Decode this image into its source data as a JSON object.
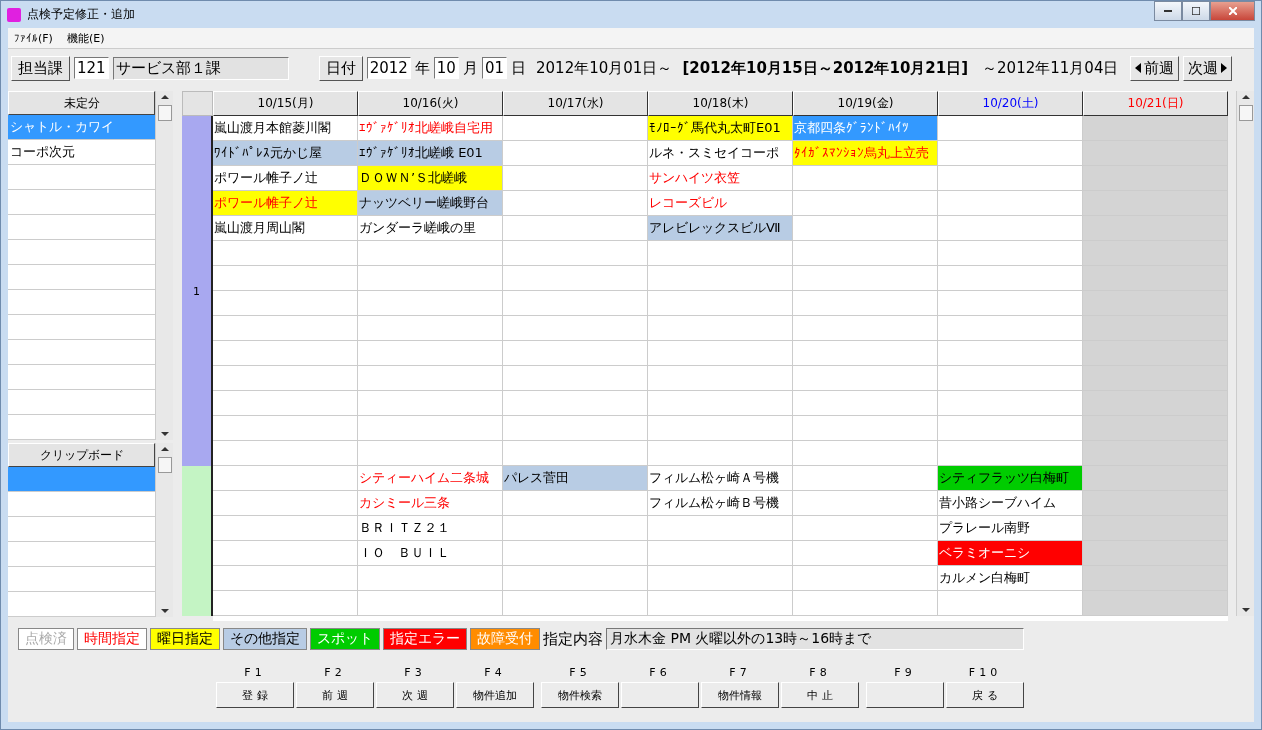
{
  "window": {
    "title": "点検予定修正・追加"
  },
  "menu": [
    {
      "label": "ﾌｧｲﾙ(F)"
    },
    {
      "label": "機能(E)"
    }
  ],
  "toolbar": {
    "department_label": "担当課",
    "department_code": "121",
    "department_name": "サービス部１課",
    "date_label": "日付",
    "year": "2012",
    "year_unit": "年",
    "month": "10",
    "month_unit": "月",
    "day": "01",
    "day_unit": "日",
    "range_start": "2012年10月01日～",
    "current_week": "[2012年10月15日～2012年10月21日]",
    "range_end": "～2012年11月04日",
    "prev_button": "前週",
    "next_button": "次週"
  },
  "unscheduled": {
    "title": "未定分",
    "items": [
      {
        "label": "シャトル・カワイ",
        "selected": true
      },
      {
        "label": "コーポ次元",
        "selected": false
      }
    ]
  },
  "clipboard": {
    "title": "クリップボード",
    "items": [
      {
        "selected": true
      }
    ]
  },
  "schedule": {
    "days": [
      {
        "label": "10/15(月)",
        "kind": "weekday"
      },
      {
        "label": "10/16(火)",
        "kind": "weekday"
      },
      {
        "label": "10/17(水)",
        "kind": "weekday"
      },
      {
        "label": "10/18(木)",
        "kind": "weekday"
      },
      {
        "label": "10/19(金)",
        "kind": "weekday"
      },
      {
        "label": "10/20(土)",
        "kind": "saturday"
      },
      {
        "label": "10/21(日)",
        "kind": "sunday"
      }
    ],
    "groups": [
      {
        "label": "1",
        "color": "#a8a8f0",
        "days": {
          "mon": [
            {
              "text": "嵐山渡月本館菱川閣",
              "kind": "none",
              "time": false
            },
            {
              "text": "ﾜｲﾄﾞﾊﾟﾚｽ元かじ屋",
              "kind": "other",
              "time": false
            },
            {
              "text": "ポワール帷子ノ辻",
              "kind": "none",
              "time": false
            },
            {
              "text": "ポワール帷子ノ辻",
              "kind": "weekday",
              "time": true
            },
            {
              "text": "嵐山渡月周山閣",
              "kind": "none",
              "time": false
            }
          ],
          "tue": [
            {
              "text": "ｴｳﾞｧｹﾞﾘｵ北嵯峨自宅用",
              "kind": "none",
              "time": true
            },
            {
              "text": "ｴｳﾞｧｹﾞﾘｵ北嵯峨 E01",
              "kind": "other",
              "time": false
            },
            {
              "text": "ＤＯＷＮ’Ｓ北嵯峨",
              "kind": "weekday",
              "time": false
            },
            {
              "text": "ナッツベリー嵯峨野台",
              "kind": "other",
              "time": false
            },
            {
              "text": "ガンダーラ嵯峨の里",
              "kind": "none",
              "time": false
            }
          ],
          "thu": [
            {
              "text": "ﾓﾉﾛｰｸﾞ馬代丸太町E01",
              "kind": "weekday",
              "time": false
            },
            {
              "text": "ルネ・スミセイコーポ",
              "kind": "none",
              "time": false
            },
            {
              "text": "サンハイツ衣笠",
              "kind": "none",
              "time": true
            },
            {
              "text": "レコーズビル",
              "kind": "none",
              "time": true
            },
            {
              "text": "アレビレックスビルⅦ",
              "kind": "other",
              "time": false
            }
          ],
          "fri": [
            {
              "text": "京都四条ｸﾞﾗﾝﾄﾞﾊｲﾂ",
              "kind": "selected",
              "time": false
            },
            {
              "text": "ﾀｲｶﾞｽﾏﾝｼｮﾝ烏丸上立売",
              "kind": "weekday",
              "time": true
            }
          ]
        }
      },
      {
        "color": "#c4f4c4",
        "days": {
          "tue": [
            {
              "text": "シティーハイム二条城",
              "kind": "none",
              "time": true
            },
            {
              "text": "カシミール三条",
              "kind": "none",
              "time": true
            },
            {
              "text": "ＢＲＩＴＺ２１",
              "kind": "none",
              "time": false
            },
            {
              "text": "ＩＯ　ＢＵＩＬ",
              "kind": "none",
              "time": false
            }
          ],
          "wed": [
            {
              "text": "パレス菅田",
              "kind": "other",
              "time": false
            }
          ],
          "thu": [
            {
              "text": "フィルム松ヶ崎Ａ号機",
              "kind": "none",
              "time": false
            },
            {
              "text": "フィルム松ヶ崎Ｂ号機",
              "kind": "none",
              "time": false
            }
          ],
          "sat": [
            {
              "text": "シティフラッツ白梅町",
              "kind": "spot",
              "time": false
            },
            {
              "text": "昔小路シーブハイム",
              "kind": "none",
              "time": false
            },
            {
              "text": "プラレール南野",
              "kind": "none",
              "time": false
            },
            {
              "text": "ベラミオーニシ",
              "kind": "error",
              "time": false
            },
            {
              "text": "カルメン白梅町",
              "kind": "none",
              "time": false
            }
          ]
        }
      }
    ]
  },
  "legend": {
    "items": [
      {
        "label": "点検済",
        "kind": "done"
      },
      {
        "label": "時間指定",
        "kind": "time"
      },
      {
        "label": "曜日指定",
        "kind": "weekday"
      },
      {
        "label": "その他指定",
        "kind": "other"
      },
      {
        "label": "スポット",
        "kind": "spot"
      },
      {
        "label": "指定エラー",
        "kind": "error"
      },
      {
        "label": "故障受付",
        "kind": "fault"
      }
    ],
    "detail_label": "指定内容",
    "detail": "月水木金 PM 火曜以外の13時～16時まで"
  },
  "function_keys": [
    {
      "key": "F1",
      "label": "登 録"
    },
    {
      "key": "F2",
      "label": "前 週"
    },
    {
      "key": "F3",
      "label": "次 週"
    },
    {
      "key": "F4",
      "label": "物件追加"
    },
    {
      "key": "F5",
      "label": "物件検索"
    },
    {
      "key": "F6"
    },
    {
      "key": "F7",
      "label": "物件情報"
    },
    {
      "key": "F8",
      "label": "中 止"
    },
    {
      "key": "F9"
    },
    {
      "key": "F10",
      "label": "戻 る"
    }
  ]
}
